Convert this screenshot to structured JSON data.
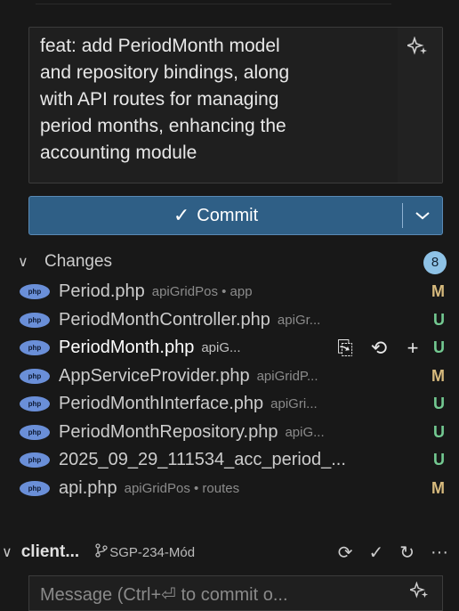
{
  "commit_message": {
    "text": "feat: add PeriodMonth model\nand repository bindings, along\nwith API routes for managing\nperiod months, enhancing the\naccounting module",
    "sparkle_icon": "sparkle-icon"
  },
  "commit_button": {
    "check": "✓",
    "label": "Commit",
    "dropdown_icon": "chevron-down-icon"
  },
  "changes": {
    "chevron": "∨",
    "title": "Changes",
    "count": "8",
    "files": [
      {
        "name": "Period.php",
        "path": "apiGridPos • app",
        "status": "M"
      },
      {
        "name": "PeriodMonthController.php",
        "path": "apiGr...",
        "status": "U"
      },
      {
        "name": "PeriodMonth.php",
        "path": "apiG...",
        "status": "U"
      },
      {
        "name": "AppServiceProvider.php",
        "path": "apiGridP...",
        "status": "M"
      },
      {
        "name": "PeriodMonthInterface.php",
        "path": "apiGri...",
        "status": "U"
      },
      {
        "name": "PeriodMonthRepository.php",
        "path": "apiG...",
        "status": "U"
      },
      {
        "name": "2025_09_29_111534_acc_period_...",
        "path": "",
        "status": "U"
      },
      {
        "name": "api.php",
        "path": "apiGridPos • routes",
        "status": "M"
      }
    ],
    "row_actions": {
      "open_file": "⎘",
      "discard": "⟲",
      "stage": "+"
    }
  },
  "repo_section": {
    "chevron": "∨",
    "repo_name": "client...",
    "branch_icon": "branch-icon",
    "branch": "SGP-234-Mód",
    "actions": [
      "⟳",
      "✓",
      "↻",
      "···"
    ]
  },
  "message_input": {
    "placeholder": "Message (Ctrl+⏎ to commit o..."
  },
  "colors": {
    "commit_button": "#2f5f86",
    "badge": "#8ec2e6",
    "modified": "#d7ba7d",
    "untracked": "#73c991",
    "php_icon": "#6a8fd8"
  }
}
